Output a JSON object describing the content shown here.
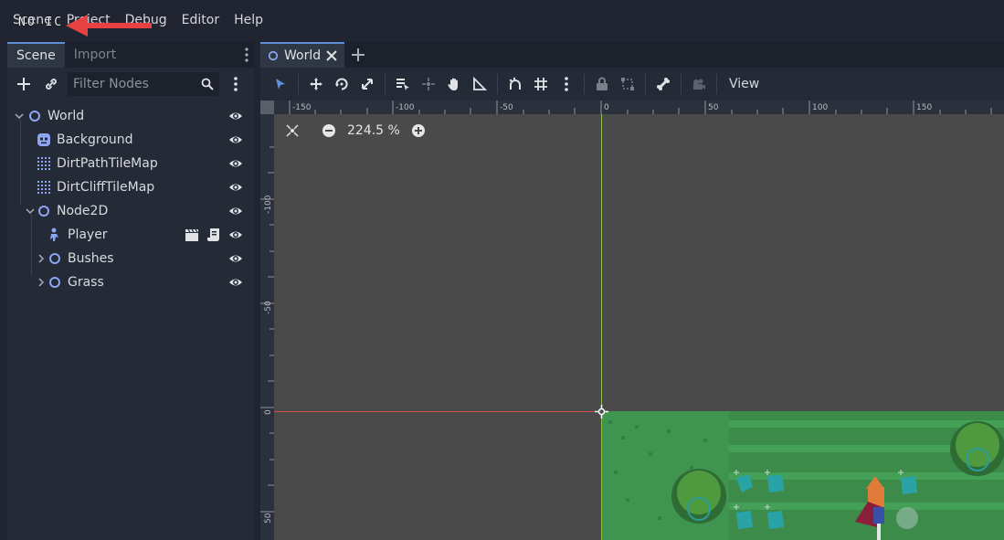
{
  "menubar": {
    "items": [
      "Scene",
      "Project",
      "Debug",
      "Editor",
      "Help"
    ]
  },
  "overlay": {
    "text": "NO IC"
  },
  "left_dock": {
    "tabs": [
      "Scene",
      "Import"
    ],
    "filter_placeholder": "Filter Nodes",
    "tree": [
      {
        "label": "World",
        "icon": "node-circle-icon"
      },
      {
        "label": "Background",
        "icon": "sprite-icon"
      },
      {
        "label": "DirtPathTileMap",
        "icon": "tilemap-icon"
      },
      {
        "label": "DirtCliffTileMap",
        "icon": "tilemap-icon"
      },
      {
        "label": "Node2D",
        "icon": "node-circle-icon"
      },
      {
        "label": "Player",
        "icon": "kinematic-body-icon"
      },
      {
        "label": "Bushes",
        "icon": "node-circle-icon"
      },
      {
        "label": "Grass",
        "icon": "node-circle-icon"
      }
    ]
  },
  "editor": {
    "scene_tab": "World",
    "view_label": "View",
    "zoom": "224.5 %",
    "ruler_top": [
      "-150",
      "-100",
      "-50",
      "0",
      "50",
      "100",
      "150"
    ],
    "ruler_left": [
      "-100",
      "-50",
      "0",
      "50"
    ]
  },
  "colors": {
    "accent": "#5e90d8",
    "select_tool": "#5e90d8",
    "x_axis": "#d34d4d",
    "y_axis": "#8bc34a",
    "node_icon": "#8da5f3",
    "arrow": "#e84141"
  }
}
